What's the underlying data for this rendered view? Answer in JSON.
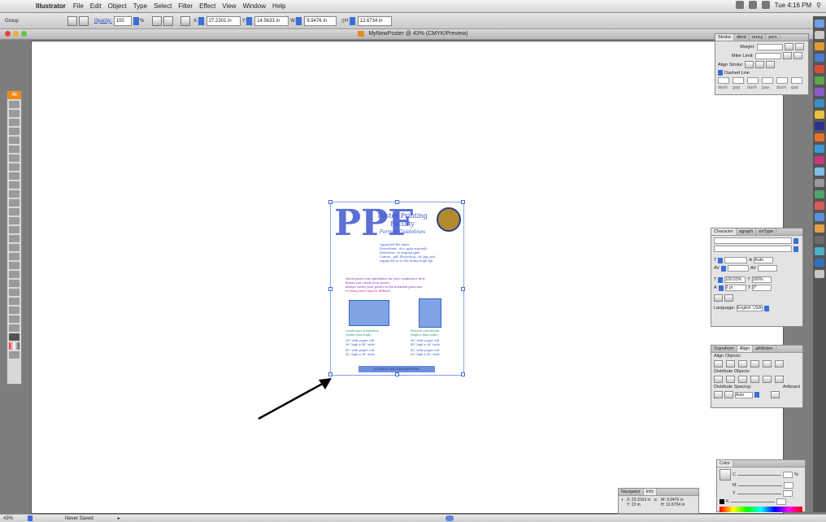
{
  "menubar": {
    "app_name": "Illustrator",
    "items": [
      "File",
      "Edit",
      "Object",
      "Type",
      "Select",
      "Filter",
      "Effect",
      "View",
      "Window",
      "Help"
    ],
    "clock": "Tue 4:16 PM"
  },
  "controlbar": {
    "selection_label": "Group",
    "opacity_label": "Opacity:",
    "opacity_value": "100",
    "pct": "%",
    "x_label": "X:",
    "x_value": "27.2301 in",
    "y_label": "Y:",
    "y_value": "14.5633 in",
    "w_label": "W:",
    "w_value": "9.9476 in",
    "h_label": "H:",
    "h_value": "12.6734 in"
  },
  "document": {
    "title": "MyNewPoster @ 43% (CMYK/Preview)"
  },
  "tools": {
    "badge": "Ai"
  },
  "stroke_panel": {
    "tabs": [
      "Stroke",
      "dient",
      "rency",
      "yers"
    ],
    "weight_label": "Weight:",
    "miter_label": "Miter Limit:",
    "align_label": "Align Stroke:",
    "dashed_label": "Dashed Line",
    "dash_labels": [
      "dash",
      "gap",
      "dash",
      "gap",
      "dash",
      "gap"
    ]
  },
  "character_panel": {
    "tabs": [
      "Character",
      "agraph",
      "enType"
    ],
    "size_value": "Auto",
    "scale_v": "100.53%",
    "scale_h": "100%",
    "baseline": "0 pt",
    "rotate": "0°",
    "language_label": "Language:",
    "language_value": "English: USA"
  },
  "align_panel": {
    "tabs": [
      "Transform",
      "Align",
      "athfinder"
    ],
    "align_objects": "Align Objects:",
    "distribute_objects": "Distribute Objects:",
    "distribute_spacing": "Distribute Spacing:",
    "artboard": "Artboard",
    "spacing_value": "Auto"
  },
  "color_panel": {
    "tabs": [
      "Color"
    ],
    "channels": [
      "C",
      "M",
      "Y",
      "K"
    ],
    "pct": "%"
  },
  "info_panel": {
    "tabs": [
      "Navigator",
      "Info"
    ],
    "x_label": "X:",
    "x_value": "22.3163 in",
    "y_label": "Y:",
    "y_value": "23 in",
    "w_label": "W:",
    "w_value": "9.9476 in",
    "h_label": "H:",
    "h_value": "12.6734 in"
  },
  "poster": {
    "logo": "PPF",
    "title_lines": [
      "Poster Printing",
      "Facility",
      "Format Guidelines"
    ],
    "supported": [
      "supported file types:",
      "PowerPoint, .doc,.pptx originals",
      "Illustrator, .ai original pptx",
      "Canvas, .pdf,.Photoshop, .tif,.jpg,.psd",
      "supply file as to the format,high dpi"
    ],
    "guidelines": [
      "check poster size guidelines for your conference first,",
      "before you create your poster.",
      "always create your poster in the intended print size.",
      "re-sizing later may be difficult."
    ],
    "landscape_label": "Landscape orientation",
    "portrait_label": "Portrait orientation",
    "landscape_sub": "(wider than high)",
    "portrait_sub": "(higher than wide)",
    "sizes_left": [
      "36\" wide paper roll",
      "36\" high x 48\" wide",
      "42\" wide paper roll",
      "42\" high x 56\" wide"
    ],
    "sizes_right": [
      "36\" wide paper roll",
      "48\" high x 36\" wide",
      "42\" wide paper roll",
      "56\" high x 42\" wide"
    ],
    "footer": "SCIENCE AND ENGINEERING"
  },
  "statusbar": {
    "zoom": "43%",
    "status": "Never Saved"
  }
}
